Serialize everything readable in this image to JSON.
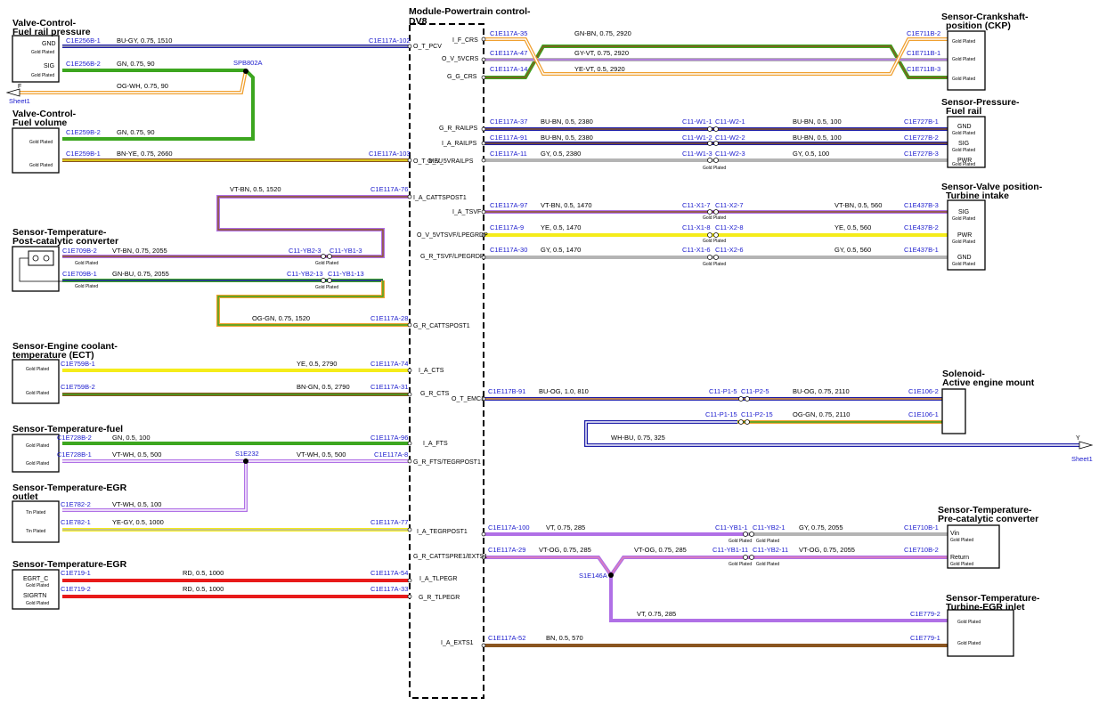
{
  "module": {
    "title1": "Module-Powertrain control-",
    "title2": "DV8"
  },
  "components": {
    "fuel_pressure_valve": {
      "t1": "Valve-Control-",
      "t2": "Fuel rail pressure",
      "pins": [
        "GND",
        "SIG"
      ]
    },
    "fuel_volume_valve": {
      "t1": "Valve-Control-",
      "t2": "Fuel volume"
    },
    "post_cat_sensor": {
      "t1": "Sensor-Temperature-",
      "t2": "Post-catalytic converter"
    },
    "ect_sensor": {
      "t1": "Sensor-Engine coolant-",
      "t2": "temperature (ECT)"
    },
    "fuel_temp_sensor": {
      "t1": "Sensor-Temperature-fuel"
    },
    "egr_outlet_sensor": {
      "t1": "Sensor-Temperature-EGR",
      "t2": "outlet"
    },
    "egr_sensor": {
      "t1": "Sensor-Temperature-EGR",
      "pins": [
        "EGRT_C",
        "SIGRTN"
      ]
    },
    "ckp_sensor": {
      "t1": "Sensor-Crankshaft-",
      "t2": "position (CKP)"
    },
    "fuel_rail_sensor": {
      "t1": "Sensor-Pressure-",
      "t2": "Fuel rail",
      "pins": [
        "GND",
        "SIG",
        "PWR"
      ]
    },
    "turbine_valve_sensor": {
      "t1": "Sensor-Valve position-",
      "t2": "Turbine intake",
      "pins": [
        "SIG",
        "PWR",
        "GND"
      ]
    },
    "engine_mount": {
      "t1": "Solenoid-",
      "t2": "Active engine mount"
    },
    "pre_cat_sensor": {
      "t1": "Sensor-Temperature-",
      "t2": "Pre-catalytic converter",
      "pins": [
        "Vin",
        "Return"
      ]
    },
    "turbine_egr_sensor": {
      "t1": "Sensor-Temperature-",
      "t2": "Turbine-EGR inlet"
    }
  },
  "labels": {
    "gold": "Gold Plated",
    "tin": "Tin Plated",
    "offpage_f": "F",
    "sheet_f": "Sheet1",
    "offpage_y": "Y",
    "sheet_y": "Sheet1",
    "splice_spb": "SPB802A",
    "splice_s1e232": "S1E232",
    "splice_s1e146": "S1E146A"
  },
  "connectors": {
    "c1": "C1E256B-1",
    "c2": "C1E117A-102",
    "c3": "C1E256B-2",
    "c4": "C1E259B-2",
    "c5": "C1E259B-1",
    "c6": "C1E117A-103",
    "c7": "C1E117A-76",
    "c8": "C1E709B-2",
    "c9": "C11-YB2-3",
    "c10": "C11-YB1-3",
    "c11": "C1E709B-1",
    "c12": "C11-YB2-13",
    "c13": "C11-YB1-13",
    "c14": "C1E117A-28",
    "c15": "C1E759B-1",
    "c16": "C1E117A-74",
    "c17": "C1E759B-2",
    "c18": "C1E117A-31",
    "c19": "C1E728B-2",
    "c20": "C1E117A-96",
    "c21": "C1E728B-1",
    "c22": "C1E117A-8",
    "c23": "C1E782-2",
    "c24": "C1E782-1",
    "c25": "C1E117A-77",
    "c26": "C1E719-1",
    "c27": "C1E117A-54",
    "c28": "C1E719-2",
    "c29": "C1E117A-33",
    "r1": "C1E117A-35",
    "r2": "C1E711B-2",
    "r3": "C1E117A-47",
    "r4": "C1E711B-1",
    "r5": "C1E117A-14",
    "r6": "C1E711B-3",
    "r7": "C1E117A-37",
    "r8": "C11-W1-1",
    "r9": "C11-W2-1",
    "r10": "C1E727B-1",
    "r11": "C1E117A-91",
    "r12": "C11-W1-2",
    "r13": "C11-W2-2",
    "r14": "C1E727B-2",
    "r15": "C1E117A-11",
    "r16": "C11-W1-3",
    "r17": "C11-W2-3",
    "r18": "C1E727B-3",
    "r19": "C1E117A-97",
    "r20": "C11-X1-7",
    "r21": "C11-X2-7",
    "r22": "C1E437B-3",
    "r23": "C1E117A-9",
    "r24": "C11-X1-8",
    "r25": "C11-X2-8",
    "r26": "C1E437B-2",
    "r27": "C1E117A-30",
    "r28": "C11-X1-6",
    "r29": "C11-X2-6",
    "r30": "C1E437B-1",
    "r31": "C1E117B-91",
    "r32": "C11-P1-5",
    "r33": "C11-P2-5",
    "r34": "C1E106-2",
    "r35": "C11-P1-15",
    "r36": "C11-P2-15",
    "r37": "C1E106-1",
    "r38": "C1E117A-100",
    "r39": "C11-YB1-1",
    "r40": "C11-YB2-1",
    "r41": "C1E710B-1",
    "r42": "C1E117A-29",
    "r43": "C11-YB1-11",
    "r44": "C11-YB2-11",
    "r45": "C1E710B-2",
    "r46": "C1E779-2",
    "r47": "C1E117A-52",
    "r48": "C1E779-1"
  },
  "wires": {
    "w1": "BU-GY, 0.75, 1510",
    "w2": "GN, 0.75, 90",
    "w3": "OG-WH, 0.75, 90",
    "w4": "GN, 0.75, 90",
    "w5": "BN-YE, 0.75, 2660",
    "w6": "VT-BN, 0.5, 1520",
    "w7": "VT-BN, 0.75, 2055",
    "w8": "GN-BU, 0.75, 2055",
    "w9": "OG-GN, 0.75, 1520",
    "w10": "YE, 0.5, 2790",
    "w11": "BN-GN, 0.5, 2790",
    "w12": "GN, 0.5, 100",
    "w13": "VT-WH, 0.5, 500",
    "w14": "VT-WH, 0.5, 500",
    "w15": "VT-WH, 0.5, 100",
    "w16": "YE-GY, 0.5, 1000",
    "w17": "RD, 0.5, 1000",
    "w18": "RD, 0.5, 1000",
    "r1": "GN-BN, 0.75, 2920",
    "r2": "GY-VT, 0.75, 2920",
    "r3": "YE-VT, 0.5, 2920",
    "r4": "BU-BN, 0.5, 2380",
    "r5": "BU-BN, 0.5, 100",
    "r6": "BU-BN, 0.5, 2380",
    "r7": "BU-BN, 0.5, 100",
    "r8": "GY, 0.5, 2380",
    "r9": "GY, 0.5, 100",
    "r10": "VT-BN, 0.5, 1470",
    "r11": "VT-BN, 0.5, 560",
    "r12": "YE, 0.5, 1470",
    "r13": "YE, 0.5, 560",
    "r14": "GY, 0.5, 1470",
    "r15": "GY, 0.5, 560",
    "r16": "BU-OG, 1.0, 810",
    "r17": "BU-OG, 0.75, 2110",
    "r18": "OG-GN, 0.75, 2110",
    "r19": "WH-BU, 0.75, 325",
    "r20": "VT, 0.75, 285",
    "r21": "GY, 0.75, 2055",
    "r22": "VT-OG, 0.75, 285",
    "r23": "VT-OG, 0.75, 285",
    "r24": "VT-OG, 0.75, 2055",
    "r25": "VT, 0.75, 285",
    "r26": "BN, 0.5, 570"
  },
  "signals": {
    "s1": "O_T_PCV",
    "s2": "O_T_MEU",
    "s3": "I_A_CATTSPOST1",
    "s4": "G_R_CATTSPOST1",
    "s5": "I_A_CTS",
    "s6": "G_R_CTS",
    "s7": "I_A_FTS",
    "s8": "G_R_FTS/TEGRPOST1",
    "s9": "I_A_TEGRPOST1",
    "s10": "G_R_CATTSPRE1/EXTS1",
    "s11": "I_A_TLPEGR",
    "s12": "G_R_TLPEGR",
    "s13": "I_A_EXTS1",
    "s14": "I_F_CRS",
    "s15": "O_V_5VCRS",
    "s16": "G_G_CRS",
    "s17": "G_R_RAILPS",
    "s18": "I_A_RAILPS",
    "s19": "O_V_5VRAILPS",
    "s20": "I_A_TSVF",
    "s21": "O_V_5VTSVF/LPEGRDP",
    "s22": "G_R_TSVF/LPEGRDP",
    "s23": "O_T_EMC1"
  },
  "colors": {
    "blue": "#1f1fa8",
    "green": "#3ca61f",
    "orange": "#f0a030",
    "violet": "#b070e6",
    "brown": "#8a5520",
    "yellow": "#f5ec1a",
    "grey": "#b4b4b4",
    "red": "#e81a1a",
    "pink": "#e080b8",
    "connector_text": "#1a1acd"
  }
}
